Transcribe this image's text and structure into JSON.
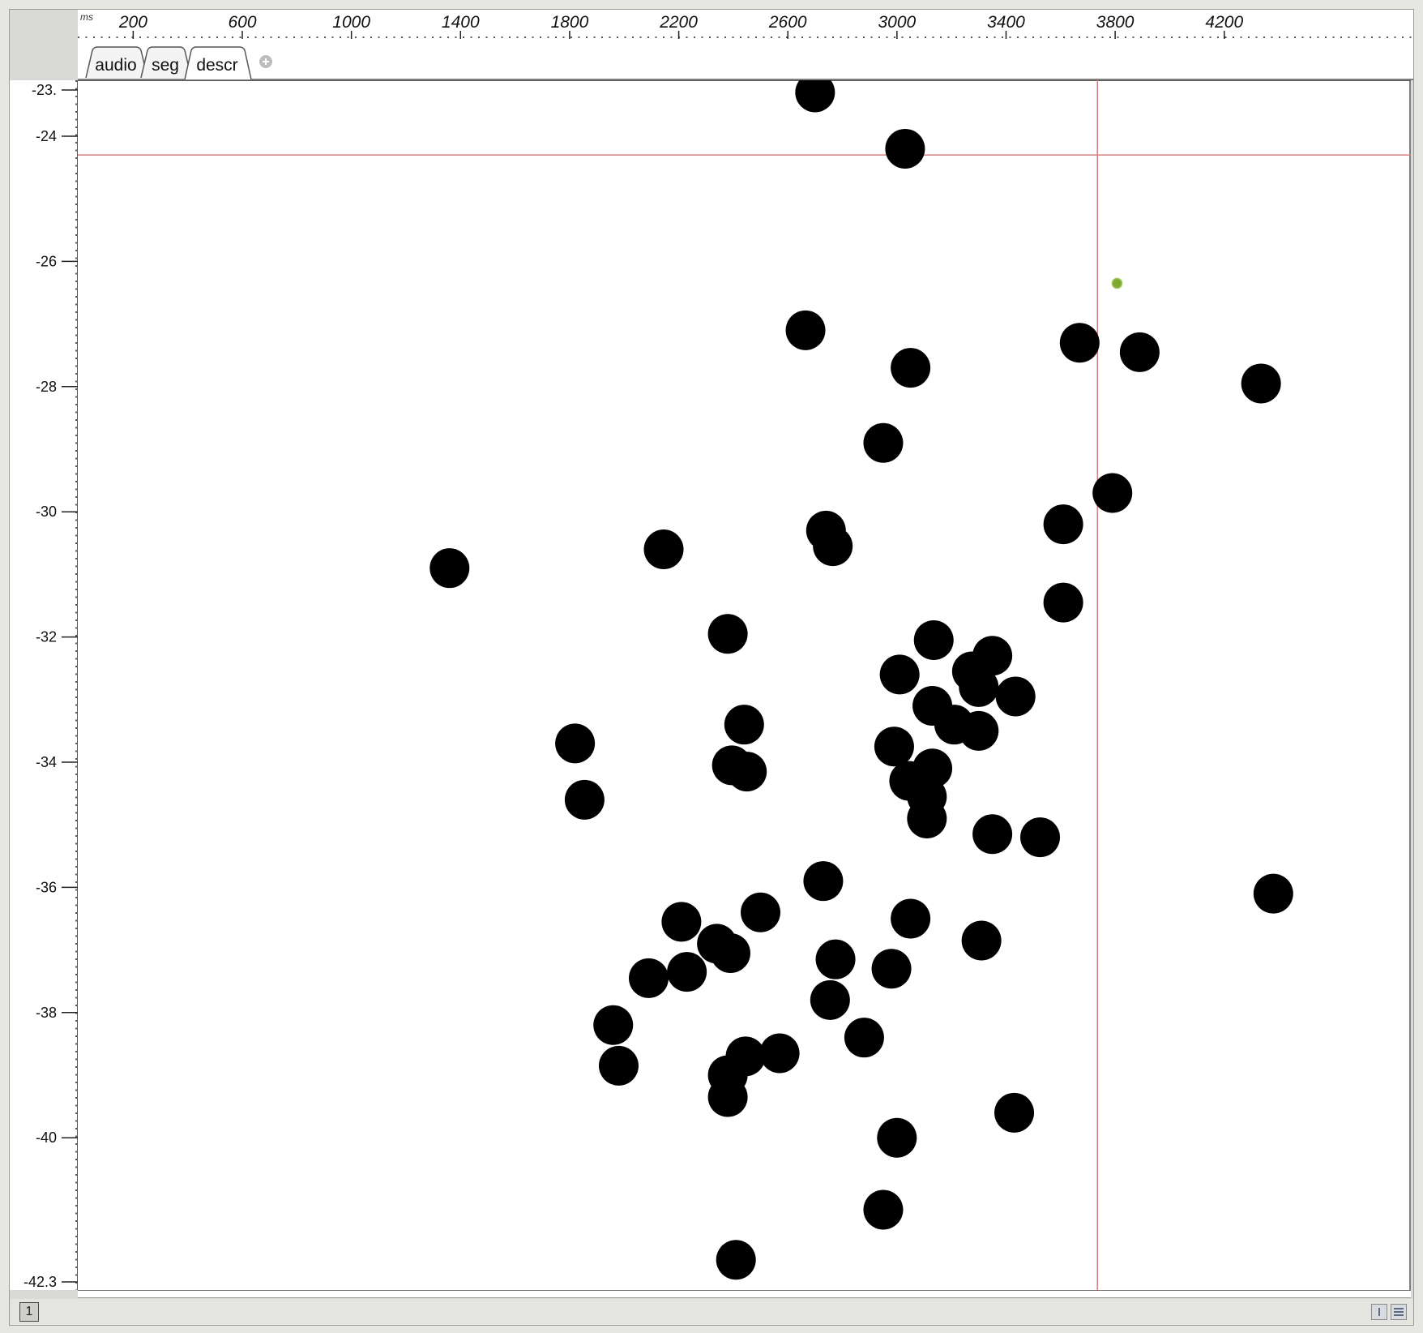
{
  "ruler": {
    "unit": "ms",
    "ticks": [
      "200",
      "600",
      "1000",
      "1400",
      "1800",
      "2200",
      "2600",
      "3000",
      "3400",
      "3800",
      "4200"
    ]
  },
  "tabs": [
    {
      "label": "audio",
      "active": false
    },
    {
      "label": "seg",
      "active": false
    },
    {
      "label": "descr",
      "active": true
    }
  ],
  "add_tab_icon": "plus-circle-icon",
  "status": {
    "page": "1"
  },
  "colors": {
    "points": "#000000",
    "cursor": "#d08080",
    "highlight_point": "#7fa832"
  },
  "chart_data": {
    "type": "scatter",
    "xlabel": "ms",
    "ylabel": "",
    "xlim": [
      -15,
      4420
    ],
    "ylim": [
      -42.3,
      -23.0
    ],
    "y_tick_labels": [
      "-23.",
      "-24",
      "-26",
      "-28",
      "-30",
      "-32",
      "-34",
      "-36",
      "-38",
      "-40",
      "-42.3"
    ],
    "cursor": {
      "x": 3735,
      "y": -24.3
    },
    "highlight_point": {
      "x": 3792,
      "y": -26.35
    },
    "series": [
      {
        "points": [
          [
            2685,
            -23.3
          ],
          [
            3015,
            -24.2
          ],
          [
            2650,
            -27.1
          ],
          [
            3035,
            -27.7
          ],
          [
            3655,
            -27.3
          ],
          [
            3875,
            -27.45
          ],
          [
            4320,
            -27.95
          ],
          [
            2935,
            -28.9
          ],
          [
            1345,
            -30.9
          ],
          [
            2130,
            -30.6
          ],
          [
            2725,
            -30.3
          ],
          [
            2750,
            -30.55
          ],
          [
            3595,
            -30.2
          ],
          [
            3775,
            -29.7
          ],
          [
            2365,
            -31.95
          ],
          [
            3595,
            -31.45
          ],
          [
            3120,
            -32.05
          ],
          [
            3260,
            -32.55
          ],
          [
            3335,
            -32.3
          ],
          [
            2995,
            -32.6
          ],
          [
            3285,
            -32.8
          ],
          [
            3420,
            -32.95
          ],
          [
            1805,
            -33.7
          ],
          [
            2425,
            -33.4
          ],
          [
            3115,
            -33.1
          ],
          [
            3195,
            -33.4
          ],
          [
            3285,
            -33.5
          ],
          [
            2975,
            -33.75
          ],
          [
            2380,
            -34.05
          ],
          [
            2435,
            -34.15
          ],
          [
            3115,
            -34.1
          ],
          [
            3030,
            -34.3
          ],
          [
            3095,
            -34.55
          ],
          [
            1840,
            -34.6
          ],
          [
            3095,
            -34.9
          ],
          [
            3335,
            -35.15
          ],
          [
            3510,
            -35.2
          ],
          [
            2715,
            -35.9
          ],
          [
            4365,
            -36.1
          ],
          [
            2485,
            -36.4
          ],
          [
            2195,
            -36.55
          ],
          [
            3035,
            -36.5
          ],
          [
            3295,
            -36.85
          ],
          [
            2325,
            -36.9
          ],
          [
            2375,
            -37.05
          ],
          [
            2760,
            -37.15
          ],
          [
            2965,
            -37.3
          ],
          [
            2075,
            -37.45
          ],
          [
            2215,
            -37.35
          ],
          [
            2740,
            -37.8
          ],
          [
            1945,
            -38.2
          ],
          [
            2865,
            -38.4
          ],
          [
            2555,
            -38.65
          ],
          [
            2430,
            -38.7
          ],
          [
            1965,
            -38.85
          ],
          [
            2365,
            -39.0
          ],
          [
            2365,
            -39.35
          ],
          [
            3415,
            -39.6
          ],
          [
            2985,
            -40.0
          ],
          [
            2935,
            -41.15
          ],
          [
            2395,
            -41.95
          ]
        ]
      }
    ]
  }
}
